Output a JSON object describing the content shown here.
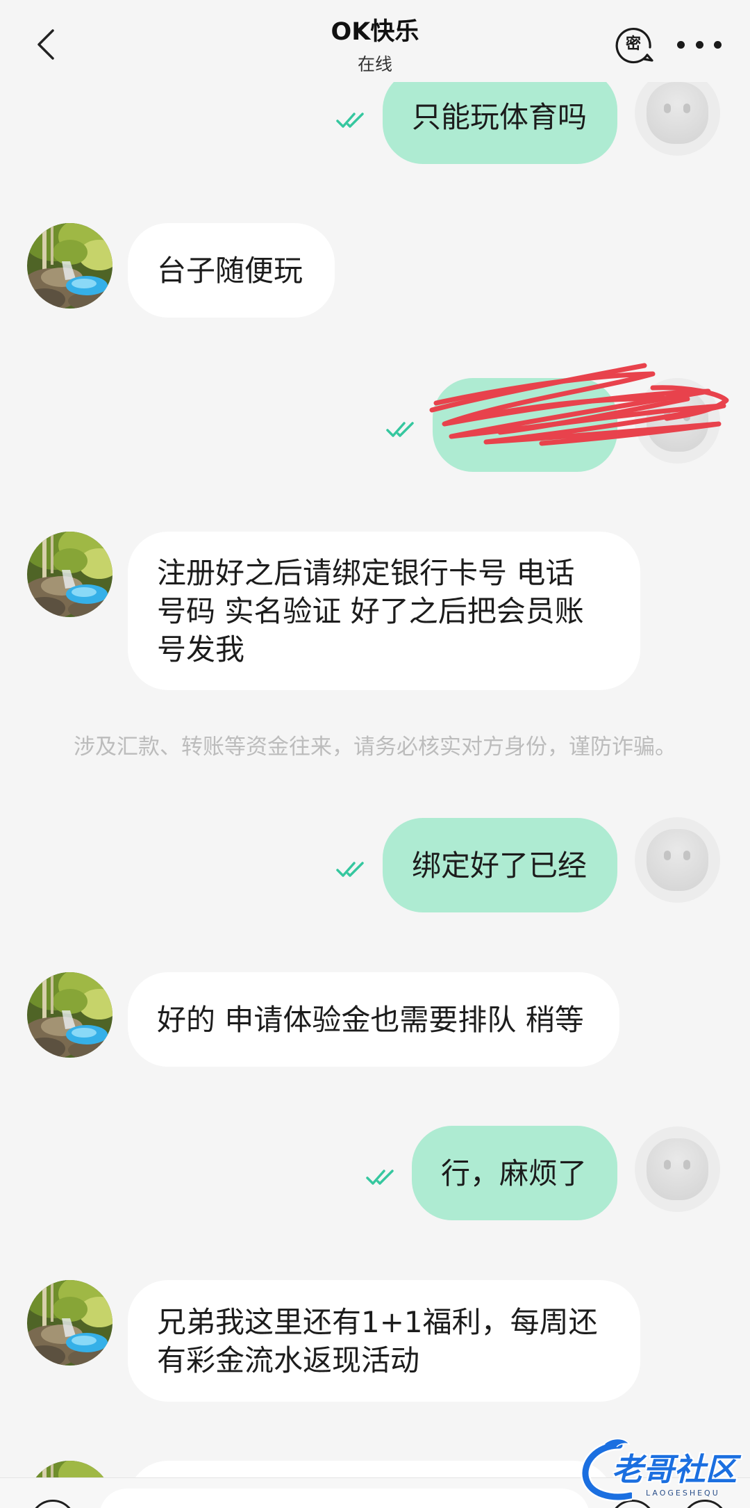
{
  "header": {
    "back_icon": "chevron-left-icon",
    "title": "OK快乐",
    "status": "在线",
    "secret_chat_icon": "secret-chat-icon",
    "secret_chat_label": "密",
    "more_icon": "more-dots-icon"
  },
  "avatars": {
    "contact": "waterfall-photo-avatar",
    "me": "default-avatar-icon"
  },
  "messages": [
    {
      "side": "outgoing",
      "lines": [
        "只能玩体育吗"
      ],
      "status_icon": "double-check-icon"
    },
    {
      "side": "incoming",
      "lines": [
        "台子随便玩"
      ]
    },
    {
      "side": "outgoing",
      "lines": [],
      "status_icon": "double-check-icon"
    },
    {
      "side": "incoming",
      "lines": [
        "注册好之后请绑定银行卡号  电话",
        "号码  实名验证 好了之后把会员账",
        "号发我"
      ]
    },
    {
      "side": "system",
      "lines": [
        "涉及汇款、转账等资金往来，请务必核实对方身份，谨防诈骗。"
      ]
    },
    {
      "side": "outgoing",
      "lines": [
        "绑定好了已经"
      ],
      "status_icon": "double-check-icon"
    },
    {
      "side": "incoming",
      "lines": [
        "好的 申请体验金也需要排队 稍等"
      ]
    },
    {
      "side": "outgoing",
      "lines": [
        "行，麻烦了"
      ],
      "status_icon": "double-check-icon"
    },
    {
      "side": "incoming",
      "lines": [
        "兄弟我这里还有1+1福利，每周还",
        "有彩金流水返现活动"
      ]
    },
    {
      "side": "incoming",
      "lines": []
    }
  ],
  "composer": {
    "voice_icon": "voice-icon",
    "emoji_icon": "emoji-icon",
    "add_icon": "add-icon"
  },
  "watermark": {
    "text": "老哥社区",
    "subtext": "LAOGESHEQU"
  },
  "colors": {
    "background": "#f5f5f5",
    "outgoing_bubble": "#aeebd2",
    "incoming_bubble": "#ffffff",
    "read_check": "#36c79f",
    "notice_text": "#bcbcbc",
    "scribble": "#e8424c",
    "watermark": "#1b6fe0"
  }
}
